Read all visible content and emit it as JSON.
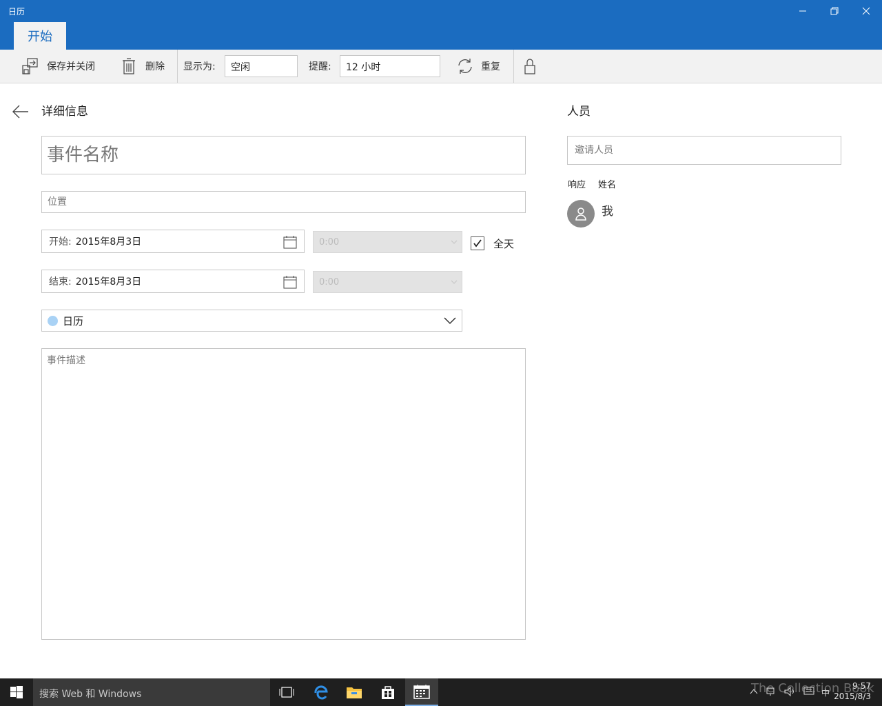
{
  "window": {
    "title": "日历"
  },
  "ribbon": {
    "tab_start": "开始"
  },
  "toolbar": {
    "save_close": "保存并关闭",
    "delete": "删除",
    "show_as_label": "显示为:",
    "show_as_value": "空闲",
    "reminder_label": "提醒:",
    "reminder_value": "12 小时",
    "repeat": "重复"
  },
  "details": {
    "title": "详细信息",
    "event_name_placeholder": "事件名称",
    "location_placeholder": "位置",
    "start_label": "开始:",
    "start_date": "2015年8月3日",
    "start_time": "0:00",
    "end_label": "结束:",
    "end_date": "2015年8月3日",
    "end_time": "0:00",
    "all_day_label": "全天",
    "all_day_checked": true,
    "calendar_name": "日历",
    "calendar_color": "#a9d2f5",
    "description_placeholder": "事件描述"
  },
  "people": {
    "title": "人员",
    "invite_placeholder": "邀请人员",
    "col_response": "响应",
    "col_name": "姓名",
    "attendees": [
      {
        "name": "我"
      }
    ]
  },
  "taskbar": {
    "search_placeholder": "搜索 Web 和 Windows",
    "ime": "中",
    "time": "9:57",
    "date": "2015/8/3",
    "watermark": "The Collection Book"
  },
  "colors": {
    "accent": "#1b6cc0",
    "toolbar_bg": "#f2f2f2",
    "taskbar_bg": "#1f1f1f"
  }
}
